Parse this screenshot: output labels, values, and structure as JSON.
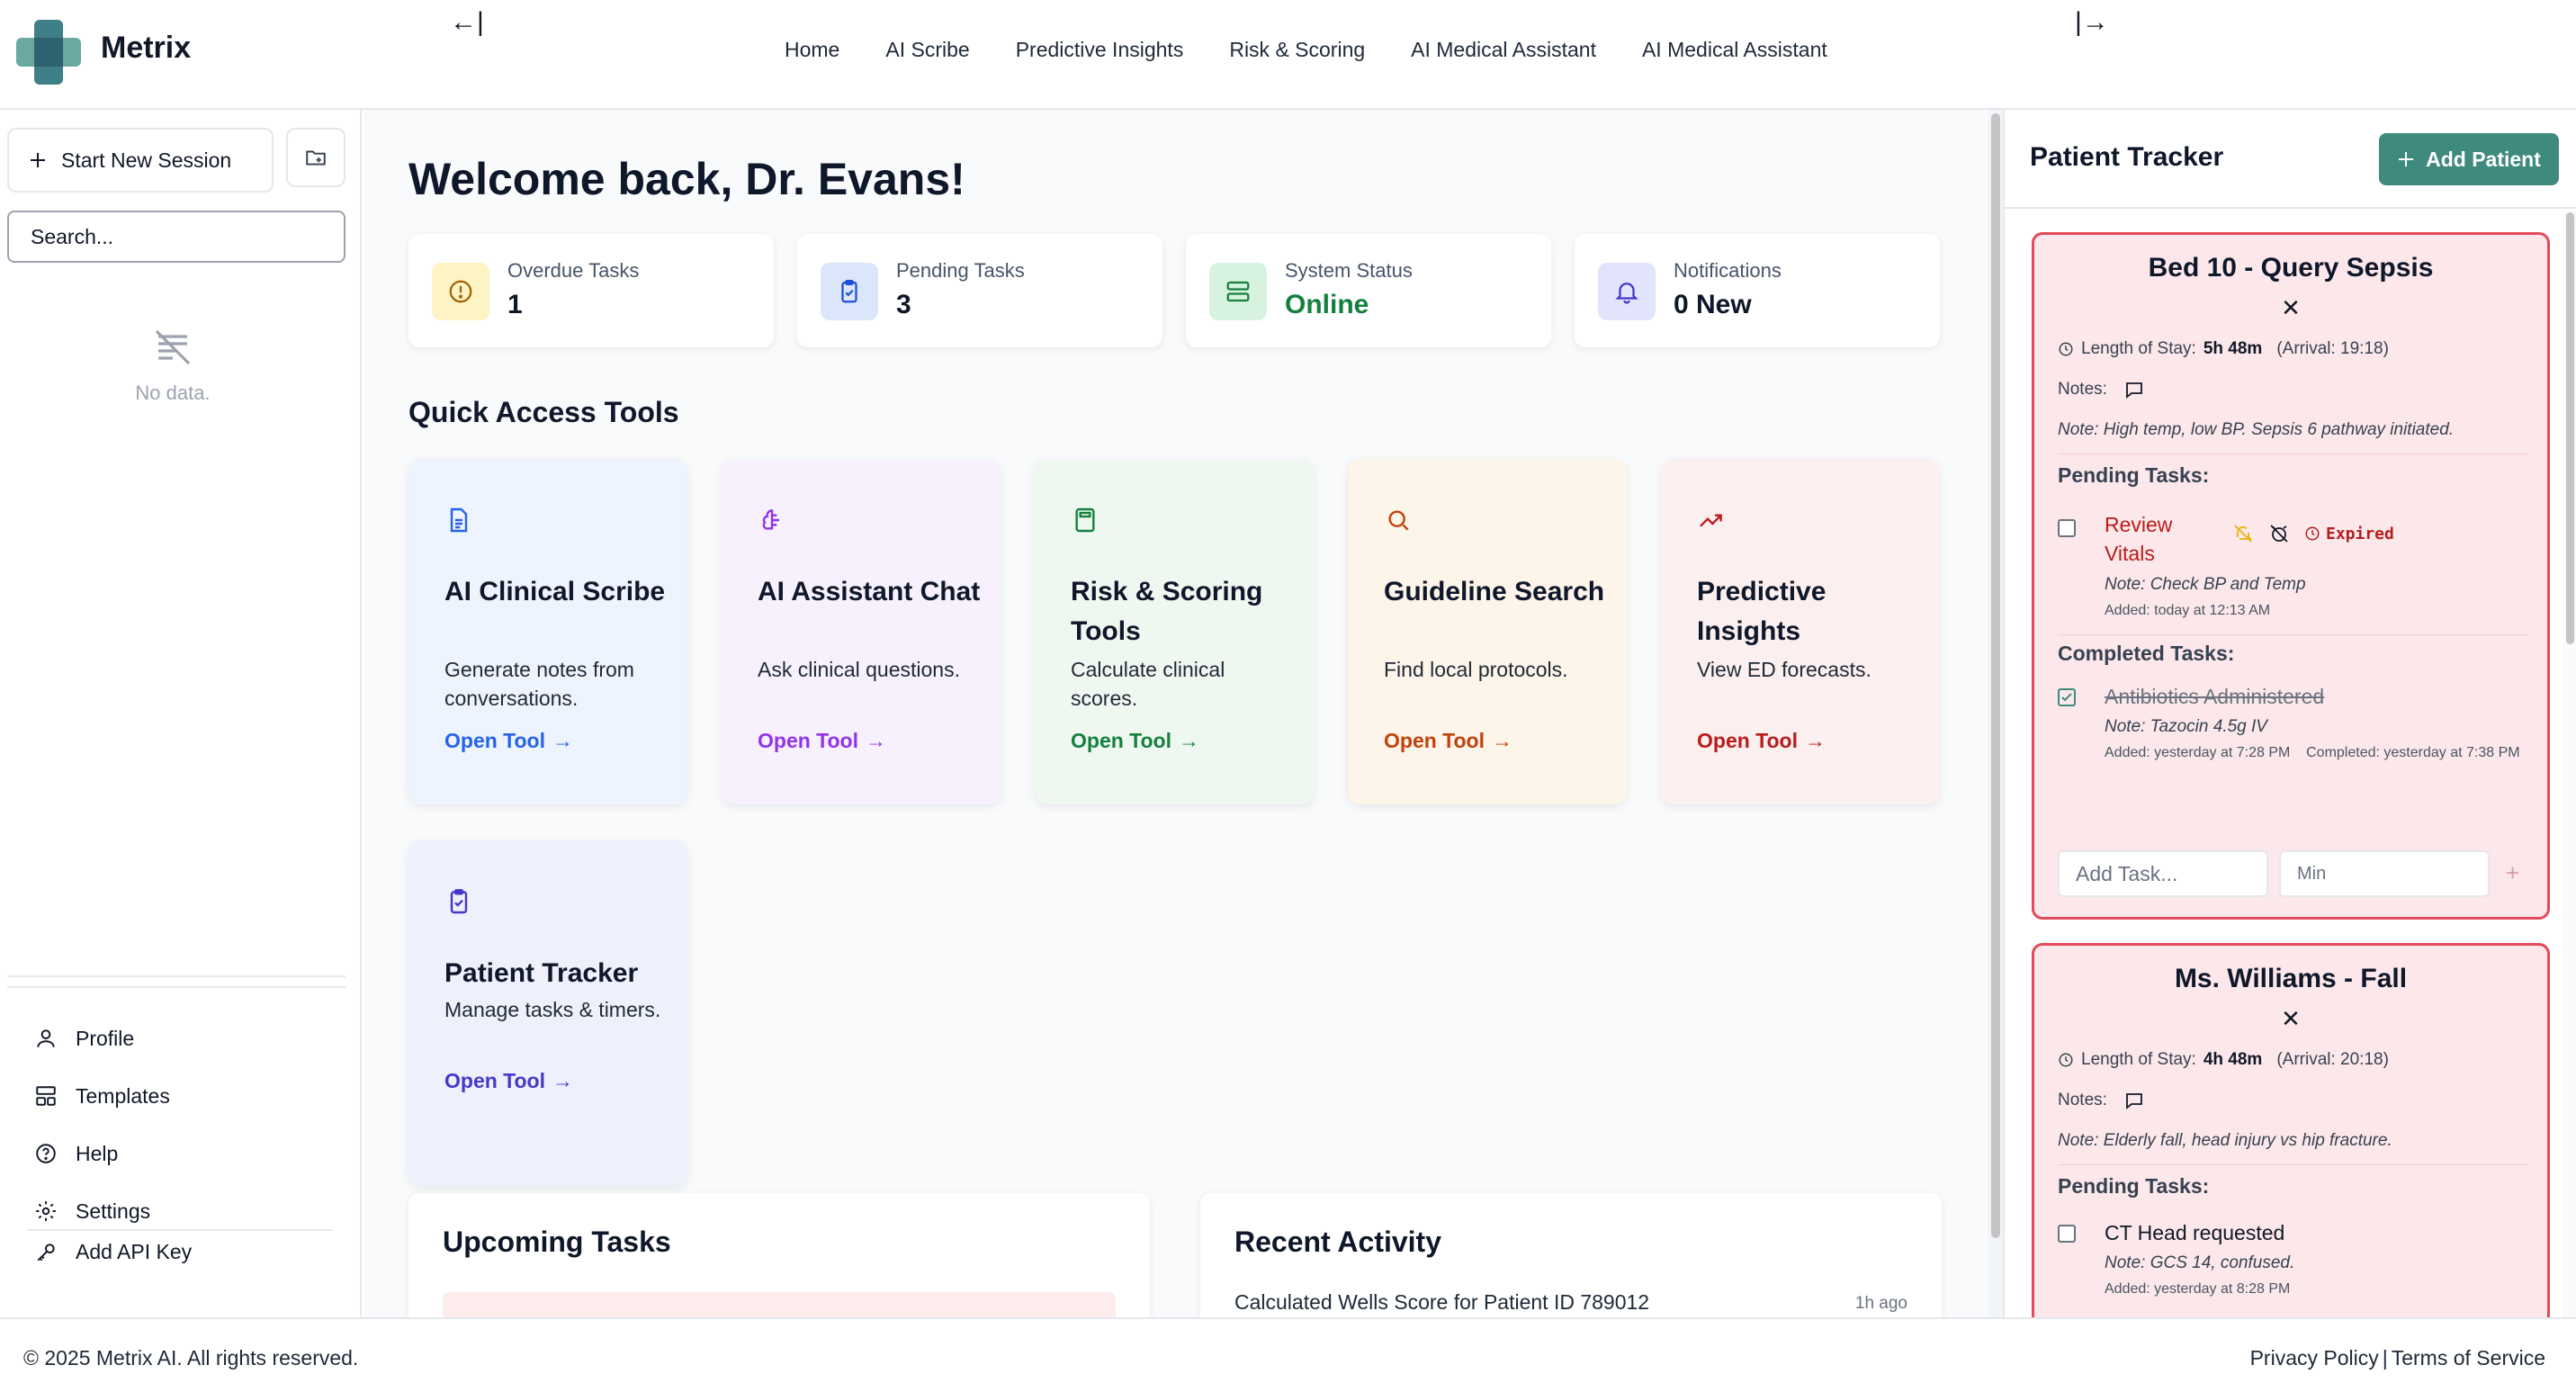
{
  "app": {
    "brand": "Metrix"
  },
  "header": {
    "collapse_left": "←|",
    "collapse_right": "|→",
    "nav": [
      "Home",
      "AI Scribe",
      "Predictive Insights",
      "Risk & Scoring",
      "AI Medical Assistant",
      "AI Medical Assistant"
    ]
  },
  "sidebar": {
    "new_session_label": "Start New Session",
    "search_placeholder": "Search...",
    "empty_text": "No data.",
    "menu": [
      {
        "label": "Profile",
        "icon": "user-icon"
      },
      {
        "label": "Templates",
        "icon": "layout-icon"
      },
      {
        "label": "Help",
        "icon": "help-icon"
      },
      {
        "label": "Settings",
        "icon": "gear-icon"
      }
    ],
    "api_key_label": "Add API Key"
  },
  "main": {
    "welcome": "Welcome back, Dr. Evans!",
    "stats": [
      {
        "label": "Overdue Tasks",
        "value": "1",
        "icon": "alert-circle-icon",
        "value_color": "#0f172a"
      },
      {
        "label": "Pending Tasks",
        "value": "3",
        "icon": "clipboard-check-icon",
        "value_color": "#0f172a"
      },
      {
        "label": "System Status",
        "value": "Online",
        "icon": "server-icon",
        "value_color": "#15803d"
      },
      {
        "label": "Notifications",
        "value": "0 New",
        "icon": "bell-icon",
        "value_color": "#0f172a"
      }
    ],
    "quick_access_title": "Quick Access Tools",
    "tools": [
      {
        "title": "AI Clinical Scribe",
        "desc": "Generate notes from conversations.",
        "link": "Open Tool",
        "color": "#2563eb",
        "bg": "#eef4fd"
      },
      {
        "title": "AI Assistant Chat",
        "desc": "Ask clinical questions.",
        "link": "Open Tool",
        "color": "#9333ea",
        "bg": "#f6f1fd"
      },
      {
        "title": "Risk & Scoring Tools",
        "desc": "Calculate clinical scores.",
        "link": "Open Tool",
        "color": "#15803d",
        "bg": "#eef8f1"
      },
      {
        "title": "Guideline Search",
        "desc": "Find local protocols.",
        "link": "Open Tool",
        "color": "#c2410c",
        "bg": "#fdf4ea"
      },
      {
        "title": "Predictive Insights",
        "desc": "View ED forecasts.",
        "link": "Open Tool",
        "color": "#b91c1c",
        "bg": "#fcefef"
      },
      {
        "title": "Patient Tracker",
        "desc": "Manage tasks & timers.",
        "link": "Open Tool",
        "color": "#4338ca",
        "bg": "#eef0fc"
      }
    ],
    "upcoming_title": "Upcoming Tasks",
    "recent_title": "Recent Activity",
    "recent_item": "Calculated Wells Score for Patient ID 789012",
    "recent_time": "1h ago"
  },
  "tracker": {
    "title": "Patient Tracker",
    "add_label": "Add Patient",
    "patients": [
      {
        "title": "Bed 10 - Query Sepsis",
        "los_label": "Length of Stay:",
        "los_value": "5h 48m",
        "arrival": "(Arrival: 19:18)",
        "notes_label": "Notes:",
        "note": "Note: High temp, low BP. Sepsis 6 pathway initiated.",
        "pending_label": "Pending Tasks:",
        "pending": [
          {
            "name": "Review Vitals",
            "status": "Expired",
            "note": "Note: Check BP and Temp",
            "added": "Added: today at 12:13 AM"
          }
        ],
        "completed_label": "Completed Tasks:",
        "completed": [
          {
            "name": "Antibiotics Administered",
            "note": "Note: Tazocin 4.5g IV",
            "added": "Added: yesterday at 7:28 PM",
            "completed": "Completed: yesterday at 7:38 PM"
          }
        ],
        "add_task_placeholder": "Add Task...",
        "min_placeholder": "Min"
      },
      {
        "title": "Ms. Williams - Fall",
        "los_label": "Length of Stay:",
        "los_value": "4h 48m",
        "arrival": "(Arrival: 20:18)",
        "notes_label": "Notes:",
        "note": "Note: Elderly fall, head injury vs hip fracture.",
        "pending_label": "Pending Tasks:",
        "pending": [
          {
            "name": "CT Head requested",
            "note": "Note: GCS 14, confused.",
            "added": "Added: yesterday at 8:28 PM"
          }
        ]
      }
    ]
  },
  "footer": {
    "copyright": "© 2025 Metrix AI. All rights reserved.",
    "privacy": "Privacy Policy",
    "separator": "|",
    "terms": "Terms of Service"
  },
  "colors": {
    "accent": "#3f8a7e",
    "danger": "#e34a5a",
    "card_bg": "#fce8ea"
  }
}
